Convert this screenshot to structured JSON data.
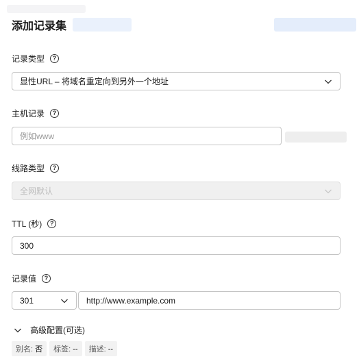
{
  "dialog": {
    "title": "添加记录集"
  },
  "record_type": {
    "label": "记录类型",
    "help_icon": "question-circle-icon",
    "value": "显性URL – 将域名重定向到另外一个地址"
  },
  "host_record": {
    "label": "主机记录",
    "placeholder": "例如www",
    "value": ""
  },
  "line_type": {
    "label": "线路类型",
    "value": "全网默认"
  },
  "ttl": {
    "label": "TTL (秒)",
    "value": "300"
  },
  "record_value": {
    "label": "记录值",
    "redirect_code": "301",
    "url": "http://www.example.com"
  },
  "advanced": {
    "label": "高级配置(可选)",
    "tags": [
      {
        "key": "别名:",
        "value": "否"
      },
      {
        "key": "标签:",
        "value": "--"
      },
      {
        "key": "描述:",
        "value": "--"
      }
    ]
  },
  "colors": {
    "border": "#c4c4c4",
    "disabled_bg": "#f0f0f0",
    "text": "#191919",
    "placeholder": "#9a9a9a"
  }
}
